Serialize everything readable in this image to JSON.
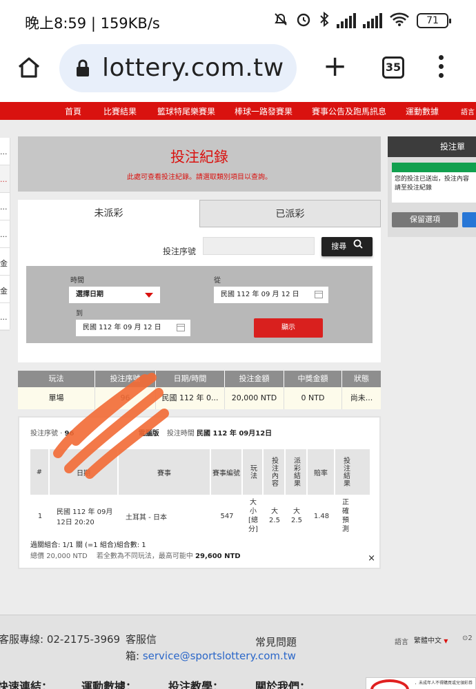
{
  "status_bar": {
    "time_speed": "晚上8:59 | 159KB/s",
    "battery": "71",
    "network": "4G"
  },
  "browser": {
    "url": "lottery.com.tw",
    "tab_count": "35"
  },
  "nav": [
    "首頁",
    "比賽結果",
    "籃球特尾樂賽果",
    "棒球一路發賽果",
    "賽事公告及跑馬訊息",
    "運動數據",
    "語言"
  ],
  "left_strip": [
    "...",
    "...",
    "...",
    "...",
    "金",
    "金",
    "..."
  ],
  "page": {
    "title": "投注紀錄",
    "subtitle": "此處可查看投注紀錄。請選取類別項目以查詢。",
    "tabs": [
      "未派彩",
      "已派彩"
    ],
    "search_label": "投注序號",
    "search_button": "搜尋",
    "time_label": "時間",
    "time_select": "選擇日期",
    "from_label": "從",
    "from_date": "民國 112 年 09 月 12 日",
    "to_label": "到",
    "to_date": "民國 112 年 09 月 12 日",
    "show_button": "顯示"
  },
  "summary_table": {
    "headers": [
      "玩法",
      "投注序號",
      "日期/時間",
      "投注金額",
      "中獎金額",
      "狀態"
    ],
    "row": [
      "單場",
      "96",
      "民國 112 年 0...",
      "20,000 NTD",
      "0 NTD",
      "尚未..."
    ]
  },
  "detail": {
    "serial_label": "投注序號",
    "serial_value": "96",
    "channel_value": "電腦版",
    "time_label": "投注時間",
    "time_value": "民國 112 年 09月12日",
    "headers": [
      "#",
      "日期",
      "賽事",
      "賽事編號",
      "玩法",
      "投注內容",
      "派彩結果",
      "賠率",
      "投注結果"
    ],
    "row": {
      "num": "1",
      "date": "民國 112 年 09月 12日 20:20",
      "match": "土耳其 - 日本",
      "code": "547",
      "play": "大小[總分]",
      "bet": "大 2.5",
      "payout": "大 2.5",
      "odds": "1.48",
      "result": "正確預測"
    },
    "combo": "過關組合: 1/1 關 (=1 組合)組合數: 1",
    "total_label": "總價",
    "total_value": "20,000 NTD",
    "max_label": "若全數為不同玩法，最高可能中",
    "max_value": "29,600 NTD",
    "close": "×"
  },
  "right_panel": {
    "title": "投注單",
    "message": "您的投注已送出，投注內容請至投注紀錄",
    "keep_button": "保留選項"
  },
  "footer": {
    "hotline": "客服專線: 02-2175-3969",
    "mail_label_1": "客服信",
    "mail_label_2": "箱:",
    "mail": "service@sportslottery.com.tw",
    "faq": "常見問題",
    "lang_label": "語言",
    "lang_value": "繁體中文",
    "quick": "快速連結：",
    "sports": "運動數據：",
    "teach": "投注教學：",
    "about": "關於我們：",
    "warning": "．未成年人不得購買或兌領彩券"
  }
}
